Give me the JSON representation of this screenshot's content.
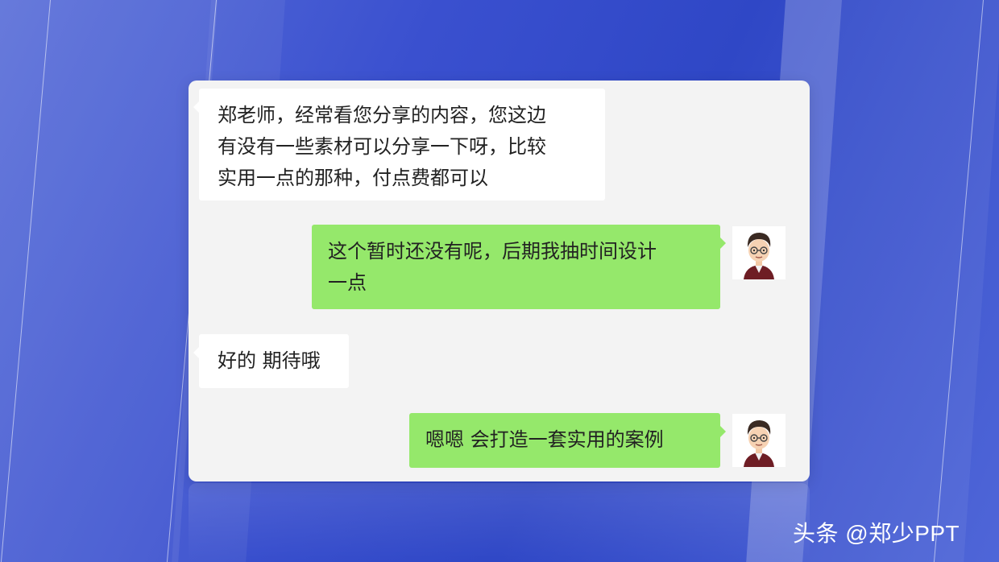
{
  "chat": {
    "messages": [
      {
        "sender": "other",
        "text": "郑老师，经常看您分享的内容，您这边\n有没有一些素材可以分享一下呀，比较\n实用一点的那种，付点费都可以"
      },
      {
        "sender": "me",
        "text": "这个暂时还没有呢，后期我抽时间设计\n一点"
      },
      {
        "sender": "other",
        "text": "好的 期待哦"
      },
      {
        "sender": "me",
        "text": "嗯嗯  会打造一套实用的案例"
      }
    ]
  },
  "watermark": {
    "text": "头条 @郑少PPT"
  },
  "colors": {
    "background": "#3a50cf",
    "chat_background": "#f3f3f3",
    "incoming_bubble": "#ffffff",
    "outgoing_bubble": "#95e86b"
  }
}
